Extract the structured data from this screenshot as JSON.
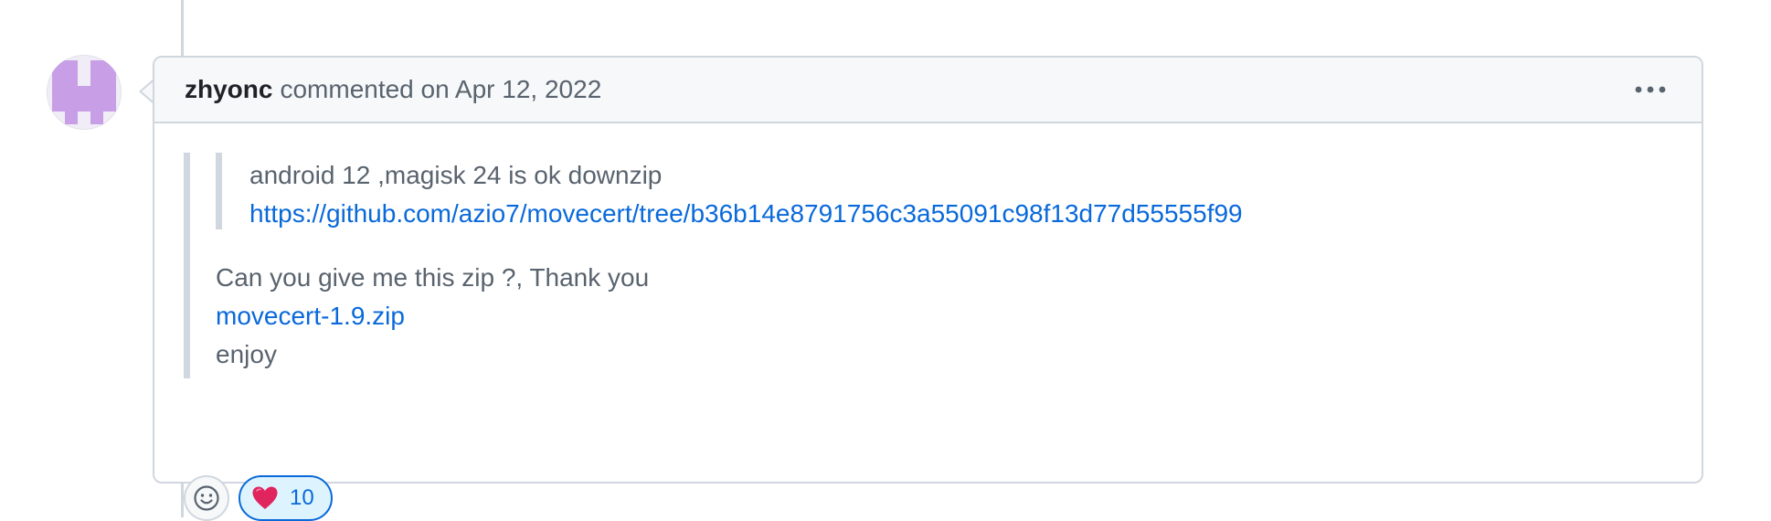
{
  "comment": {
    "author": "zhyonc",
    "meta": "commented on Apr 12, 2022",
    "quote": {
      "nested_text": "android 12 ,magisk 24 is ok downzip",
      "nested_link": "https://github.com/azio7/movecert/tree/b36b14e8791756c3a55091c98f13d77d55555f99",
      "question": "Can you give me this zip ?, Thank you",
      "file_link": "movecert-1.9.zip",
      "closing": "enjoy"
    },
    "reactions": [
      {
        "emoji": "heart",
        "count": "10"
      }
    ]
  },
  "icons": {
    "options": "kebab-horizontal-icon",
    "add_reaction": "smiley-icon",
    "reaction": "heart-icon"
  },
  "colors": {
    "link": "#0969da",
    "border": "#d0d7de",
    "header_bg": "#f6f8fa",
    "avatar": "#c89fe6",
    "reaction_bg": "#ddf4ff"
  }
}
